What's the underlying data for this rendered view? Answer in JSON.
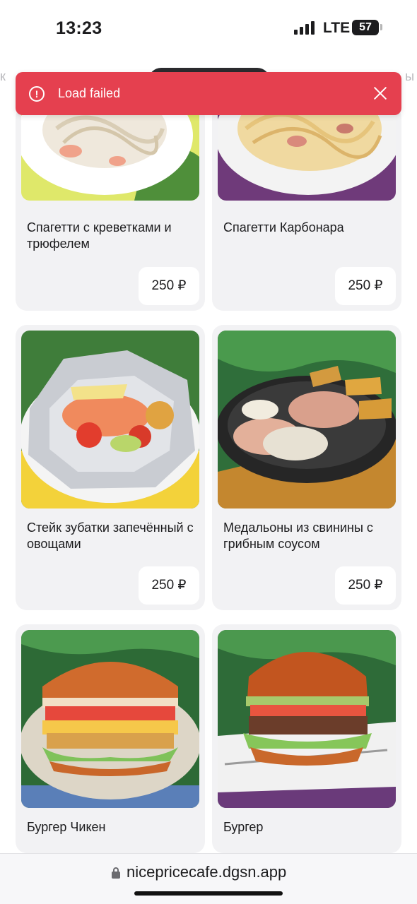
{
  "status_bar": {
    "time": "13:23",
    "network": "LTE",
    "battery": "57"
  },
  "toast": {
    "message": "Load failed",
    "icon": "alert-circle-icon",
    "close_icon": "close-icon",
    "color": "#e5404f"
  },
  "menu": {
    "items": [
      {
        "title": "Спагетти с креветками и трюфелем",
        "price": "250 ₽",
        "image": "shrimp-truffle-spaghetti-photo"
      },
      {
        "title": "Спагетти Карбонара",
        "price": "250 ₽",
        "image": "carbonara-photo"
      },
      {
        "title": "Стейк зубатки запечённый с овощами",
        "price": "250 ₽",
        "image": "baked-catfish-foil-photo"
      },
      {
        "title": "Медальоны из свинины с грибным соусом",
        "price": "250 ₽",
        "image": "pork-medallions-mushroom-photo"
      },
      {
        "title": "Бургер Чикен",
        "price": "",
        "image": "chicken-burger-photo"
      },
      {
        "title": "Бургер",
        "price": "",
        "image": "beef-burger-photo"
      }
    ]
  },
  "address_bar": {
    "url": "nicepricecafe.dgsn.app",
    "lock_icon": "lock-icon"
  }
}
